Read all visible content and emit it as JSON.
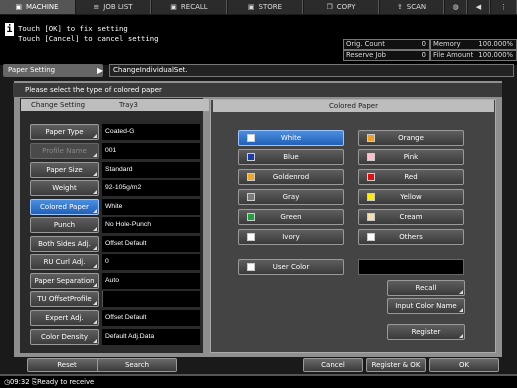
{
  "top_tabs": [
    {
      "label": "MACHINE",
      "icon": "printer-icon"
    },
    {
      "label": "JOB LIST",
      "icon": "list-icon"
    },
    {
      "label": "RECALL",
      "icon": "printer-icon"
    },
    {
      "label": "STORE",
      "icon": "printer-icon"
    },
    {
      "label": "COPY",
      "icon": "copy-icon"
    },
    {
      "label": "SCAN",
      "icon": "scan-icon"
    }
  ],
  "message": {
    "line1": "Touch [OK] to fix setting",
    "line2": "Touch [Cancel] to cancel setting"
  },
  "counters": {
    "orig_count_label": "Orig. Count",
    "orig_count_value": "0",
    "memory_label": "Memory",
    "memory_value": "100.000%",
    "reserve_job_label": "Reserve Job",
    "reserve_job_value": "0",
    "file_amount_label": "File Amount",
    "file_amount_value": "100.000%"
  },
  "breadcrumb": {
    "parent": "Paper Setting",
    "current": "ChangeIndividualSet."
  },
  "prompt": "Please select the type of colored paper",
  "left_header": {
    "title": "Change Setting",
    "tray": "Tray3"
  },
  "settings": [
    {
      "label": "Paper Type",
      "value": "Coated-G"
    },
    {
      "label": "Profile Name",
      "value": "001"
    },
    {
      "label": "Paper Size",
      "value": "Standard"
    },
    {
      "label": "Weight",
      "value": "92-105g/m2"
    },
    {
      "label": "Colored Paper",
      "value": "White"
    },
    {
      "label": "Punch",
      "value": "No Hole-Punch"
    },
    {
      "label": "Both Sides Adj.",
      "value": "Offset Default"
    },
    {
      "label": "RU Curl Adj.",
      "value": "0"
    },
    {
      "label": "Paper Separation",
      "value": "Auto"
    },
    {
      "label": "TU OffsetProfile",
      "value": ""
    },
    {
      "label": "Expert Adj.",
      "value": "Offset Default"
    },
    {
      "label": "Color Density",
      "value": "Default Adj.Data"
    }
  ],
  "right_header": "Colored Paper",
  "colors": [
    {
      "label": "White",
      "swatch": "#ffffff"
    },
    {
      "label": "Orange",
      "swatch": "#f0a020"
    },
    {
      "label": "Blue",
      "swatch": "#1a3caa"
    },
    {
      "label": "Pink",
      "swatch": "#ffc0cc"
    },
    {
      "label": "Goldenrod",
      "swatch": "#f0a820"
    },
    {
      "label": "Red",
      "swatch": "#e01010"
    },
    {
      "label": "Gray",
      "swatch": "#7a7a7a"
    },
    {
      "label": "Yellow",
      "swatch": "#ffee00"
    },
    {
      "label": "Green",
      "swatch": "#20a040"
    },
    {
      "label": "Cream",
      "swatch": "#f3dfb0"
    },
    {
      "label": "Ivory",
      "swatch": "#ffffff"
    },
    {
      "label": "Others",
      "swatch": "#ffffff"
    }
  ],
  "user_color_label": "User Color",
  "side_buttons": {
    "recall": "Recall",
    "input_color_name": "Input Color Name",
    "register": "Register"
  },
  "bottom": {
    "reset": "Reset",
    "search": "Search",
    "cancel": "Cancel",
    "register_ok": "Register & OK",
    "ok": "OK"
  },
  "status": {
    "time": "09:32",
    "text": "Ready to receive"
  }
}
